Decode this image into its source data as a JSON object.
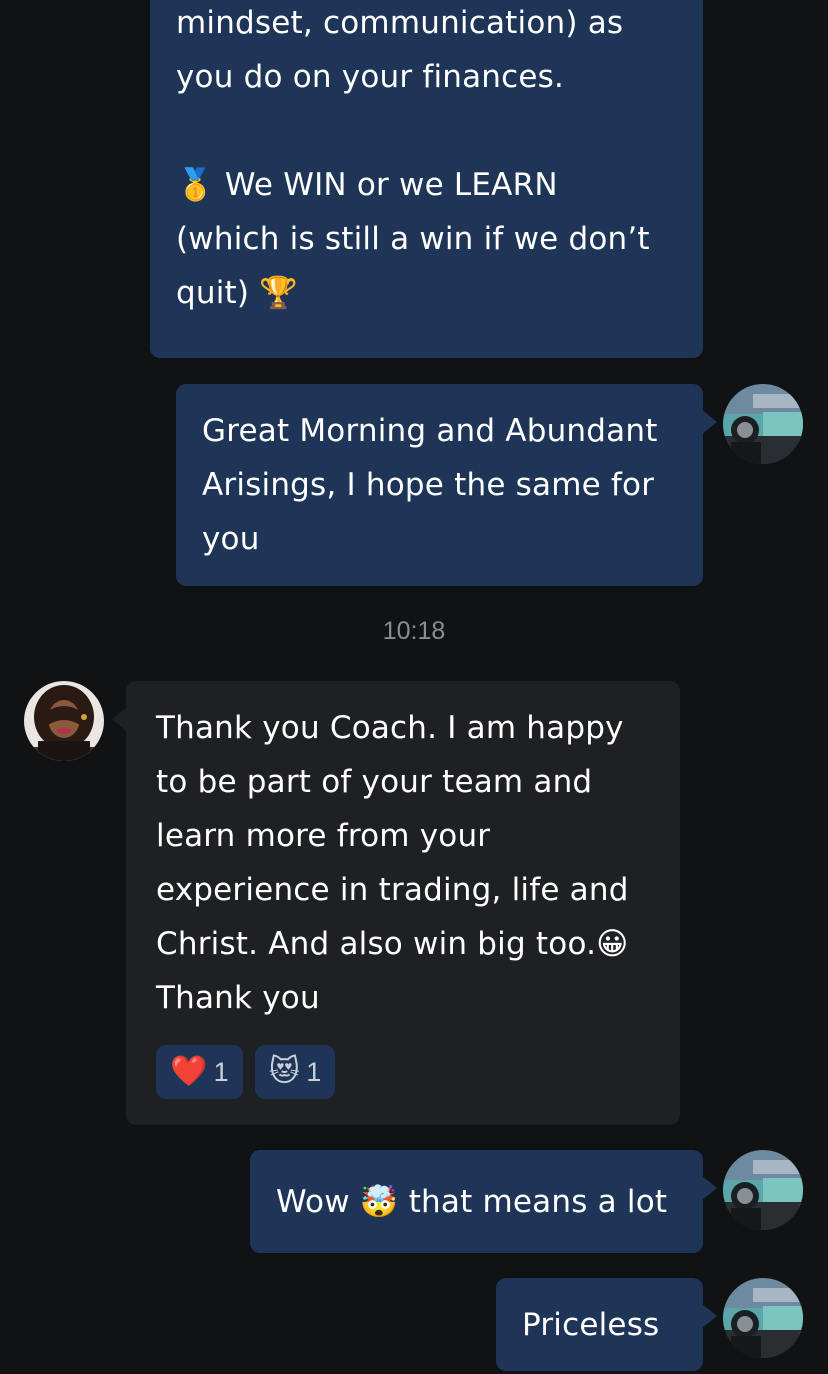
{
  "messages": {
    "m1": {
      "lines": [
        "mindset, communication) as",
        "you do on your finances.",
        "",
        "We WIN or we LEARN",
        "(which is still a win if we don’t",
        "quit)"
      ],
      "emoji_medal": "🥇",
      "emoji_trophy": "🏆"
    },
    "m2": {
      "lines": [
        "Great Morning and Abundant",
        "Arisings, I hope the same for",
        "you"
      ]
    },
    "timestamp": "10:18",
    "m3": {
      "lines": [
        "Thank you Coach. I am happy",
        "to be part of your team and",
        "learn more from your",
        "experience in trading, life and",
        "Christ.  And also win big too.",
        "Thank you"
      ],
      "emoji_grin": "😀",
      "reactions": [
        {
          "emoji": "❤️",
          "count": "1",
          "icon": "heart-icon"
        },
        {
          "emoji": "😻",
          "count": "1",
          "icon": "cat-face-icon"
        }
      ]
    },
    "m4": {
      "before": "Wow",
      "emoji": "🤯",
      "after": "that means a lot"
    },
    "m5": {
      "text": "Priceless"
    }
  },
  "colors": {
    "background": "#111214",
    "outgoing_bubble": "#1e3558",
    "incoming_bubble": "#1f2023",
    "timestamp": "#8a8d93"
  }
}
